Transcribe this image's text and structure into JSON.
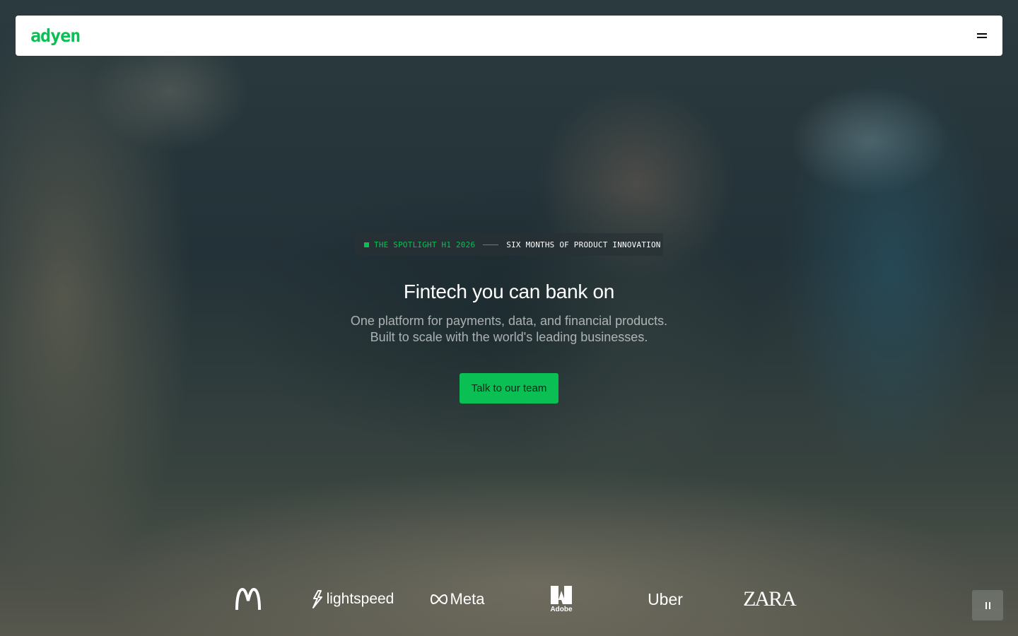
{
  "header": {
    "logo": "adyen",
    "menu_icon": "hamburger-menu-icon"
  },
  "hero": {
    "badge": {
      "event": "THE SPOTLIGHT H1 2026",
      "text": "SIX MONTHS OF PRODUCT INNOVATION"
    },
    "title": "Fintech you can bank on",
    "subtitle_line1": "One platform for payments, data, and financial products.",
    "subtitle_line2": "Built to scale with the world's leading businesses.",
    "cta_label": "Talk to our team"
  },
  "logos": {
    "lightspeed": "lightspeed",
    "meta": "Meta",
    "adobe": "Adobe",
    "uber": "Uber",
    "zara": "ZARA"
  },
  "controls": {
    "pause_icon": "pause-icon"
  },
  "colors": {
    "brand_green": "#0abf53",
    "nav_bg": "#ffffff"
  }
}
